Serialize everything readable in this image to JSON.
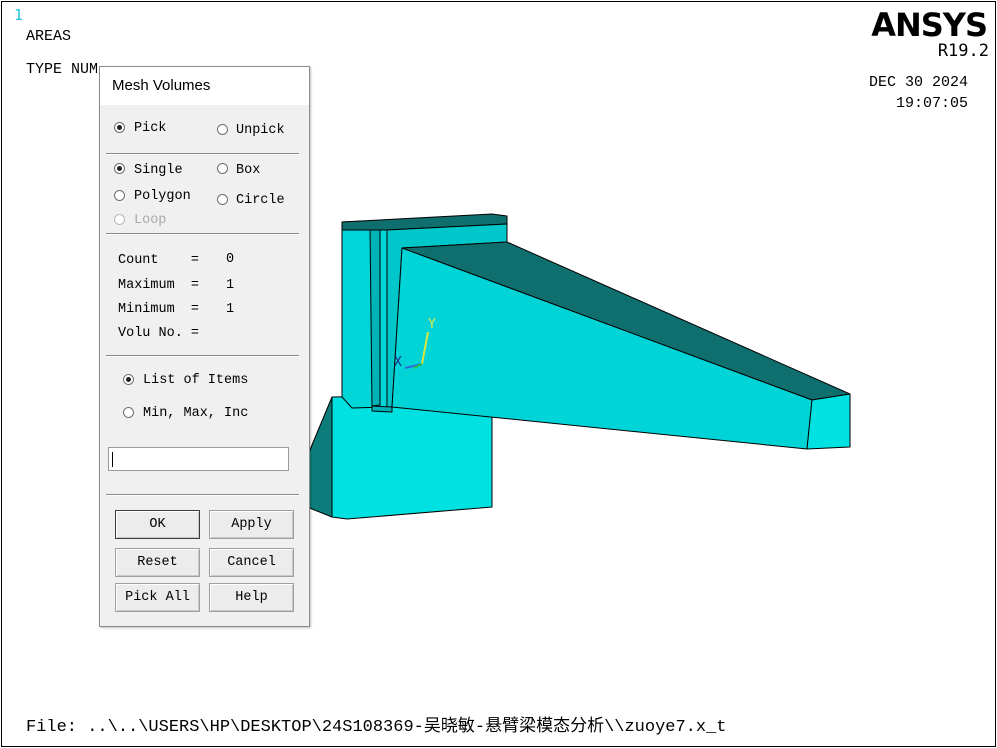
{
  "graphics": {
    "window_number": "1",
    "label_areas": "AREAS",
    "label_type_num": "TYPE NUM",
    "logo": "ANSYS",
    "version": "R19.2",
    "date": "DEC 30 2024",
    "time": "19:07:05",
    "file_path": "File: ..\\..\\USERS\\HP\\DESKTOP\\24S108369-吴晓敏-悬臂梁模态分析\\\\zuoye7.x_t",
    "triad": {
      "x_label": "X",
      "y_label": "Y"
    },
    "colors": {
      "model_face_light": "#00e1e1",
      "model_face_dark": "#00b3b6",
      "model_top": "#0f6f6e",
      "model_edge": "#000000",
      "window_number": "#25c5e0"
    }
  },
  "dialog": {
    "title": "Mesh Volumes",
    "pick_mode": {
      "pick": "Pick",
      "unpick": "Unpick",
      "selected": "Pick"
    },
    "pick_shape": {
      "single": "Single",
      "box": "Box",
      "polygon": "Polygon",
      "circle": "Circle",
      "loop": "Loop",
      "selected": "Single"
    },
    "stats": {
      "count_label": "Count    =",
      "count_value": "0",
      "maximum_label": "Maximum  =",
      "maximum_value": "1",
      "minimum_label": "Minimum  =",
      "minimum_value": "1",
      "volu_label": "Volu No. =",
      "volu_value": ""
    },
    "list_mode": {
      "list_of_items": "List of Items",
      "min_max_inc": "Min, Max, Inc",
      "selected": "List of Items"
    },
    "entry_value": "",
    "buttons": {
      "ok": "OK",
      "apply": "Apply",
      "reset": "Reset",
      "cancel": "Cancel",
      "pick_all": "Pick All",
      "help": "Help"
    }
  }
}
